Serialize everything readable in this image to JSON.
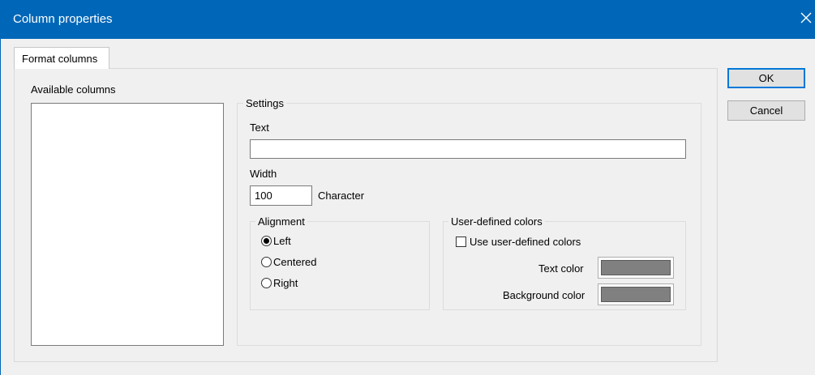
{
  "window": {
    "title": "Column properties",
    "close_icon": "close-icon"
  },
  "tabs": [
    {
      "label": "Format columns",
      "active": true
    }
  ],
  "available_columns": {
    "label": "Available columns",
    "items": []
  },
  "settings": {
    "legend": "Settings",
    "text_label": "Text",
    "text_value": "",
    "width_label": "Width",
    "width_value": "100",
    "width_unit": "Character",
    "alignment": {
      "legend": "Alignment",
      "options": [
        {
          "label": "Left",
          "selected": true
        },
        {
          "label": "Centered",
          "selected": false
        },
        {
          "label": "Right",
          "selected": false
        }
      ]
    },
    "colors": {
      "legend": "User-defined colors",
      "use_label": "Use user-defined colors",
      "use_checked": false,
      "text_color_label": "Text color",
      "text_color": "#808080",
      "background_color_label": "Background color",
      "background_color": "#808080"
    }
  },
  "buttons": {
    "ok": "OK",
    "cancel": "Cancel"
  },
  "theme": {
    "titlebar": "#0067b8",
    "accent": "#0078d7"
  }
}
